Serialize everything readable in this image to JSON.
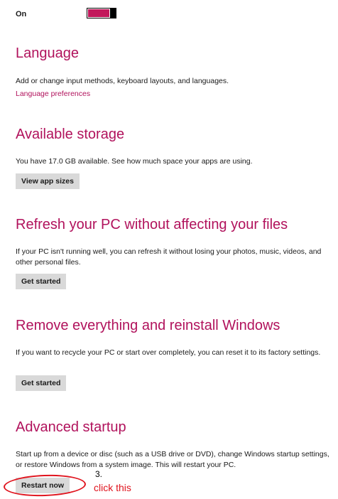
{
  "toggle": {
    "label": "On",
    "state": "on",
    "accent_color": "#c2185b"
  },
  "language": {
    "heading": "Language",
    "description": "Add or change input methods, keyboard layouts, and languages.",
    "link": "Language preferences"
  },
  "storage": {
    "heading": "Available storage",
    "description": "You have 17.0 GB available. See how much space your apps are using.",
    "button": "View app sizes"
  },
  "refresh": {
    "heading": "Refresh your PC without affecting your files",
    "description": "If your PC isn't running well, you can refresh it without losing your photos, music, videos, and other personal files.",
    "button": "Get started"
  },
  "remove": {
    "heading": "Remove everything and reinstall Windows",
    "description": "If you want to recycle your PC or start over completely, you can reset it to its factory settings.",
    "button": "Get started"
  },
  "advanced": {
    "heading": "Advanced startup",
    "description": "Start up from a device or disc (such as a USB drive or DVD), change Windows startup settings, or restore Windows from a system image. This will restart your PC.",
    "button": "Restart now"
  },
  "annotation": {
    "step": "3.",
    "text": "click this",
    "color": "#e0141e"
  },
  "colors": {
    "heading": "#b1125c",
    "button_bg": "#d9d9d9"
  }
}
